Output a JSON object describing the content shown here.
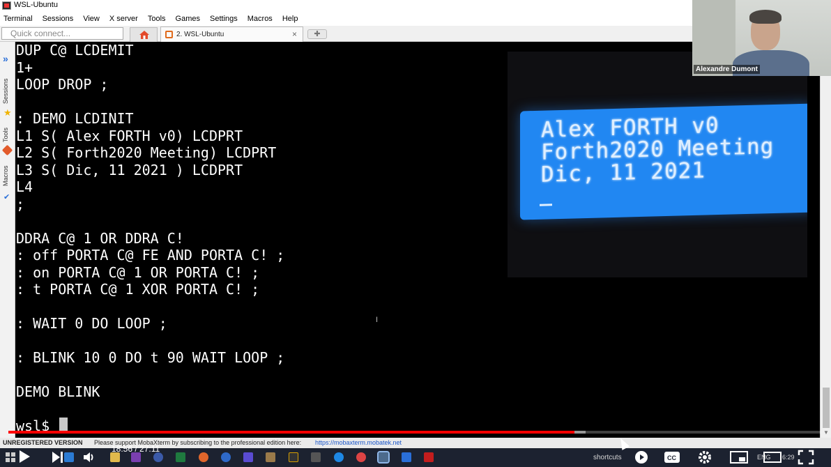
{
  "window": {
    "title": "WSL-Ubuntu"
  },
  "menu": [
    "Terminal",
    "Sessions",
    "View",
    "X server",
    "Tools",
    "Games",
    "Settings",
    "Macros",
    "Help"
  ],
  "quick_connect": {
    "placeholder": "Quick connect..."
  },
  "tabs": [
    {
      "label": "2. WSL-Ubuntu",
      "close": "×"
    }
  ],
  "sidebar": {
    "tabs": [
      "Sessions",
      "Tools",
      "Macros"
    ]
  },
  "terminal": {
    "lines": [
      "DUP C@ LCDEMIT",
      "1+",
      "LOOP DROP ;",
      "",
      ": DEMO LCDINIT",
      "L1 S( Alex FORTH v0) LCDPRT",
      "L2 S( Forth2020 Meeting) LCDPRT",
      "L3 S( Dic, 11 2021 ) LCDPRT",
      "L4",
      ";",
      "",
      "DDRA C@ 1 OR DDRA C!",
      ": off PORTA C@ FE AND PORTA C! ;",
      ": on PORTA C@ 1 OR PORTA C! ;",
      ": t PORTA C@ 1 XOR PORTA C! ;",
      "",
      ": WAIT 0 DO LOOP ;",
      "",
      ": BLINK 10 0 DO t 90 WAIT LOOP ;",
      "",
      "DEMO BLINK",
      "",
      "wsl$ "
    ]
  },
  "lcd": {
    "lines": [
      "Alex FORTH v0",
      "Forth2020 Meeting",
      "Dic, 11 2021"
    ]
  },
  "webcam": {
    "name": "Alexandre Dumont"
  },
  "status_bar": {
    "unregistered": "UNREGISTERED VERSION",
    "message": "Please support MobaXterm by subscribing to the professional edition here:",
    "link": "https://mobaxterm.mobatek.net"
  },
  "player": {
    "current_time": "18:56",
    "duration": "27:11",
    "time_display": "18:56 / 27:11",
    "progress": 0.696,
    "buffered": 0.71
  },
  "taskbar": {
    "shortcuts_label": "shortcuts",
    "language": "ENG",
    "clock": "6:29"
  },
  "colors": {
    "progress": "#ff0000",
    "lcd_background": "#2187f2",
    "terminal_background": "#000000",
    "terminal_text": "#ffffff"
  }
}
